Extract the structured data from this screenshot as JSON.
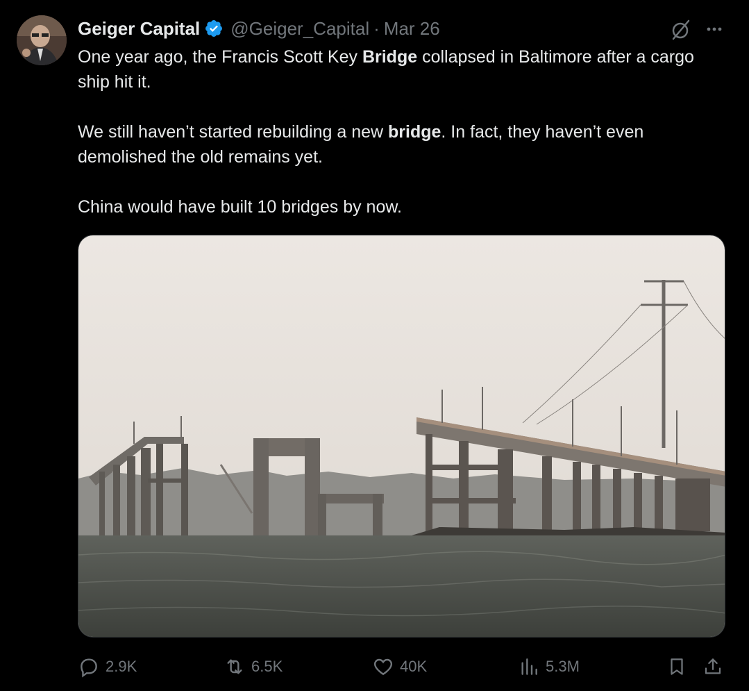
{
  "author": {
    "name": "Geiger Capital",
    "handle": "@Geiger_Capital",
    "date": "Mar 26",
    "verified": true
  },
  "tweet": {
    "line1_pre": "One year ago, the Francis Scott Key ",
    "line1_bold": "Bridge",
    "line1_post": " collapsed in Baltimore after a cargo ship hit it.",
    "line2_pre": "We still haven’t started rebuilding a new ",
    "line2_bold": "bridge",
    "line2_post": ". In fact, they haven’t even demolished the old remains yet.",
    "line3": "China would have built 10 bridges by now."
  },
  "actions": {
    "replies": "2.9K",
    "reposts": "6.5K",
    "likes": "40K",
    "views": "5.3M"
  },
  "icons": {
    "verified": "verified-badge-icon",
    "grok": "grok-icon",
    "more": "more-icon",
    "reply": "reply-icon",
    "repost": "repost-icon",
    "like": "heart-icon",
    "views": "views-icon",
    "bookmark": "bookmark-icon",
    "share": "share-icon"
  },
  "colors": {
    "background": "#000000",
    "text": "#e7e9ea",
    "muted": "#71767b",
    "verified": "#1d9bf0"
  }
}
